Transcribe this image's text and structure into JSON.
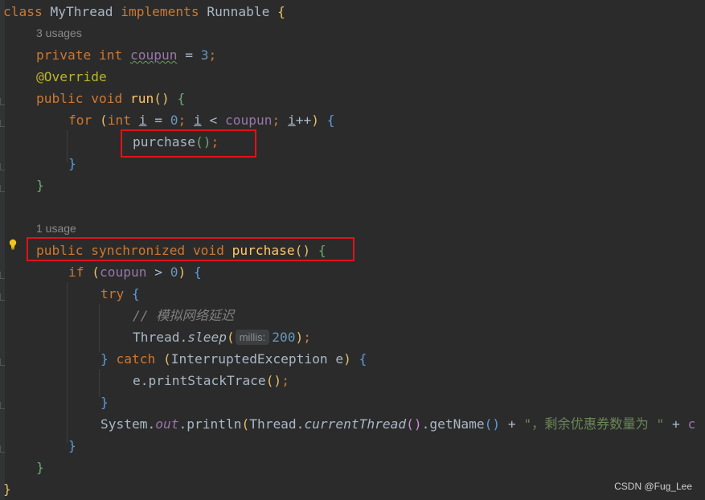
{
  "code": {
    "l1": {
      "kw_class": "class",
      "name": "MyThread",
      "kw_impl": "implements",
      "iface": "Runnable",
      "brace": "{"
    },
    "usages_a": "3 usages",
    "l2": {
      "kw_private": "private",
      "kw_int": "int",
      "field": "coupun",
      "eq": " = ",
      "num": "3",
      "semi": ";"
    },
    "l3": {
      "annotation": "@Override"
    },
    "l4": {
      "kw_public": "public",
      "kw_void": "void",
      "fn": "run",
      "parens": "()",
      "brace": "{"
    },
    "l5": {
      "kw_for": "for",
      "p_open": "(",
      "kw_int": "int",
      "var_i": "i",
      "eq": " = ",
      "zero": "0",
      "semi1": "; ",
      "var_i2": "i",
      "lt": " < ",
      "field": "coupun",
      "semi2": "; ",
      "var_i3": "i",
      "incr": "++",
      "p_close": ")",
      "brace": "{"
    },
    "l6": {
      "call": "purchase",
      "parens": "()",
      "semi": ";"
    },
    "l7": {
      "brace": "}"
    },
    "l8": {
      "brace": "}"
    },
    "usages_b": "1 usage",
    "l9": {
      "kw_public": "public",
      "kw_sync": "synchronized",
      "kw_void": "void",
      "fn": "purchase",
      "parens": "()",
      "brace": "{"
    },
    "l10": {
      "kw_if": "if",
      "p_open": "(",
      "field": "coupun",
      "gt": " > ",
      "zero": "0",
      "p_close": ")",
      "brace": "{"
    },
    "l11": {
      "kw_try": "try",
      "brace": "{"
    },
    "l12": {
      "comment": "// 模拟网络延迟"
    },
    "l13": {
      "cls": "Thread",
      "dot": ".",
      "method": "sleep",
      "p_open": "(",
      "hint": "millis:",
      "num": "200",
      "p_close": ")",
      "semi": ";"
    },
    "l14": {
      "brace_close": "}",
      "kw_catch": "catch",
      "p_open": "(",
      "exc": "InterruptedException e",
      "p_close": ")",
      "brace": "{"
    },
    "l15": {
      "call": "e.printStackTrace",
      "parens": "()",
      "semi": ";"
    },
    "l16": {
      "brace": "}"
    },
    "l17": {
      "sys": "System.",
      "out": "out",
      "println": ".println",
      "p_open": "(",
      "thread": "Thread.",
      "ct": "currentThread",
      "ct_parens": "()",
      "getname": ".getName",
      "gn_parens": "()",
      "plus": " + ",
      "str": "\"，剩余优惠券数量为 \"",
      "plus2": " + ",
      "tail": "c"
    },
    "l18": {
      "brace": "}"
    },
    "l19": {
      "brace": "}"
    },
    "l20": {
      "brace": "}"
    }
  },
  "watermark": "CSDN @Fug_Lee",
  "colors": {
    "background": "#2b2b2b",
    "keyword": "#cc7832",
    "highlight_box": "#e0121b",
    "method": "#ffc66d",
    "field": "#9876aa",
    "number": "#6897bb",
    "string": "#6a8759"
  },
  "icons": {
    "gutter_bulb": "lightbulb-icon"
  }
}
